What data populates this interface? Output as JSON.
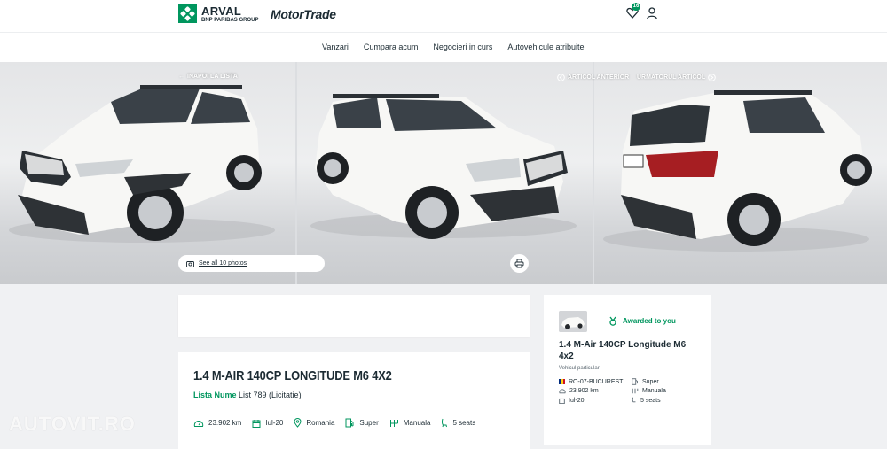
{
  "header": {
    "brand_name": "ARVAL",
    "brand_tagline": "BNP PARIBAS GROUP",
    "partner_logo": "MotorTrade",
    "favorites_count": "16",
    "icons": [
      "heart-icon",
      "user-icon"
    ]
  },
  "nav": {
    "items": [
      "Vanzari",
      "Cumpara acum",
      "Negocieri in curs",
      "Autovehicule atribuite"
    ]
  },
  "gallery": {
    "back_label": "INAPOI LA LISTA",
    "prev_label": "ARTICOL ANTERIOR",
    "next_label": "URMATORUL ARTICOL",
    "see_all_label": "See all 10 photos"
  },
  "listing": {
    "title": "1.4 M-AIR 140CP LONGITUDE M6 4X2",
    "list_label": "Lista Nume",
    "list_value": "List 789 (Licitatie)",
    "specs": {
      "mileage": "23.902 km",
      "date": "Iul-20",
      "country": "Romania",
      "fuel": "Super",
      "gearbox": "Manuala",
      "seats": "5 seats"
    }
  },
  "sidebar": {
    "awarded_label": "Awarded to you",
    "title": "1.4 M-Air 140CP Longitude M6 4x2",
    "vehicle_type": "Vehicul particular",
    "location": "RO-07-BUCUREST...",
    "fuel": "Super",
    "mileage": "23.902 km",
    "gearbox": "Manuala",
    "date": "Iul-20",
    "seats": "5 seats"
  },
  "watermark": "AUTOVIT.RO",
  "colors": {
    "brand_green": "#00965e",
    "text_dark": "#1c2b33",
    "page_bg": "#f0f1f3"
  }
}
